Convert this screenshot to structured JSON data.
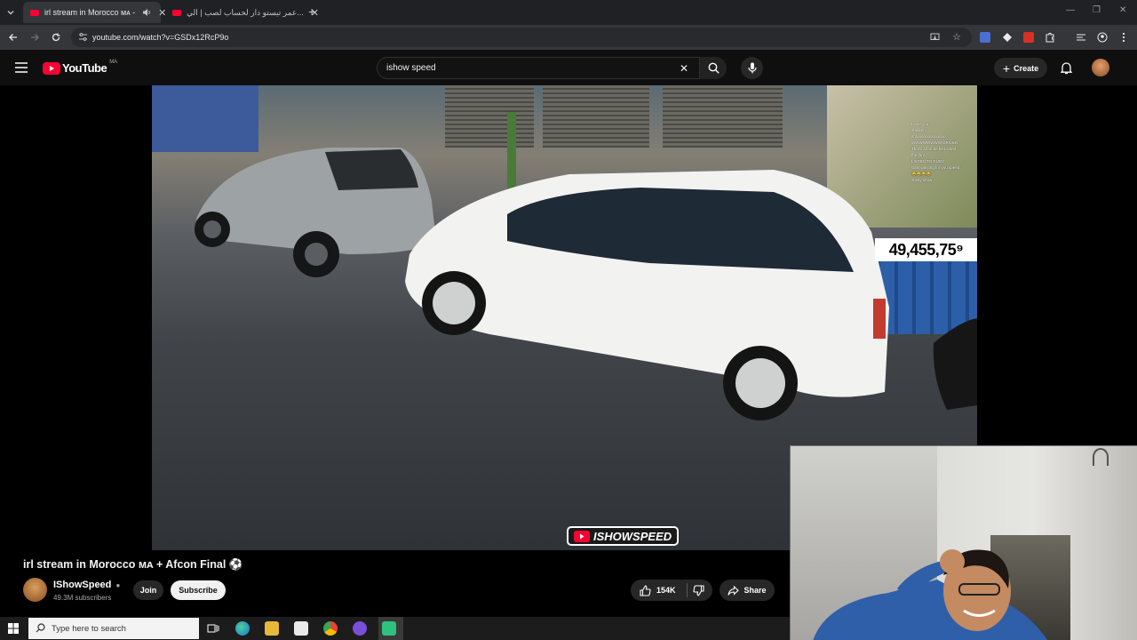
{
  "browser": {
    "tabs": [
      {
        "title": "irl stream in Morocco ᴍᴀ -",
        "active": true
      },
      {
        "title": "عمر تيستو دار لحساب لصب | الي...",
        "active": false
      }
    ],
    "new_tab_symbol": "+",
    "url": "youtube.com/watch?v=GSDx12RcP9o"
  },
  "youtube": {
    "logo_text": "YouTube",
    "region": "MA",
    "search_value": "ishow speed",
    "create_label": "Create"
  },
  "video": {
    "overlay_counter": "49,455,75⁹",
    "watermark": "ISHOWSPEED",
    "chat_lines": [
      "I love you",
      "stadium",
      "imfooooooooooooo",
      "WWWWWWWW DRIVER",
      "That's a fan he be locked",
      "the fan!",
      "LISTEN TO RUDY",
      "Girls wasting for you speed",
      "😂😂😂😂",
      "stowy show"
    ]
  },
  "meta": {
    "title": "irl stream in Morocco ᴍᴀ + Afcon Final ⚽",
    "channel": "IShowSpeed",
    "subscribers": "49.3M subscribers",
    "join_label": "Join",
    "subscribe_label": "Subscribe",
    "likes": "154K",
    "share_label": "Share"
  },
  "taskbar": {
    "search_placeholder": "Type here to search"
  },
  "colors": {
    "youtube_red": "#ff0033",
    "page_bg": "#0f0f0f",
    "chrome_frame": "#202124"
  }
}
